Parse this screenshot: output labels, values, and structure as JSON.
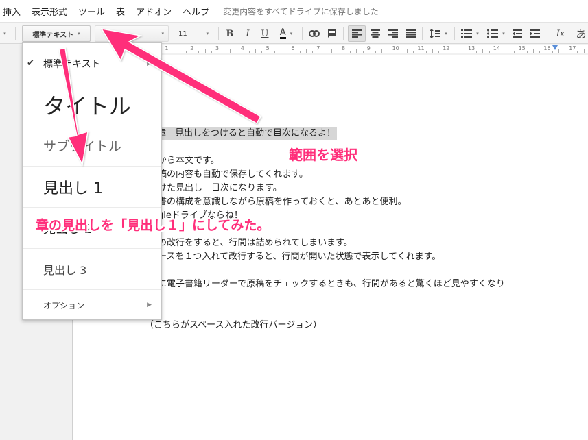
{
  "menubar": {
    "items": [
      "挿入",
      "表示形式",
      "ツール",
      "表",
      "アドオン",
      "ヘルプ"
    ],
    "save_status": "変更内容をすべてドライブに保存しました"
  },
  "toolbar": {
    "style_select": "標準テキスト",
    "font_size": "11",
    "bold": "B",
    "italic": "I",
    "underline": "U",
    "text_color": "A",
    "clear_format": "Ix",
    "overflow": "あ"
  },
  "ruler": {
    "numbers": [
      "1",
      "2",
      "1",
      "1",
      "2",
      "3",
      "4",
      "5",
      "6",
      "7",
      "8",
      "9",
      "10",
      "11",
      "12",
      "13",
      "14",
      "15",
      "16",
      "17"
    ]
  },
  "style_dropdown": {
    "items": [
      {
        "label": "標準テキスト",
        "checked": true
      },
      {
        "label": "タイトル"
      },
      {
        "label": "サブタイトル"
      },
      {
        "label": "見出し 1"
      },
      {
        "label": "見出し 2"
      },
      {
        "label": "見出し 3"
      },
      {
        "label": "オプション"
      }
    ]
  },
  "document": {
    "lines": [
      "章　見出しをつけると自動で目次になるよ！",
      "から本文です。",
      "稿の内容も自動で保存してくれます。",
      "けた見出し＝目次になります。",
      "書の構成を意識しながら原稿を作っておくと、あとあと便利。",
      "gleドライブならね！",
      "の改行をすると、行間は詰められてしまいます。",
      "ースを１つ入れて改行すると、行間が開いた状態で表示してくれます。",
      "に電子書籍リーダーで原稿をチェックするときも、行間があると驚くほど見やすくなり",
      "。",
      "（こちらがスペース入れた改行バージョン）"
    ]
  },
  "annotations": {
    "select_range": "範囲を選択",
    "heading_note": "章の見出しを「見出し１」にしてみた。"
  },
  "colors": {
    "annotation": "#ff2e7a",
    "selection": "#d6d6d6"
  }
}
